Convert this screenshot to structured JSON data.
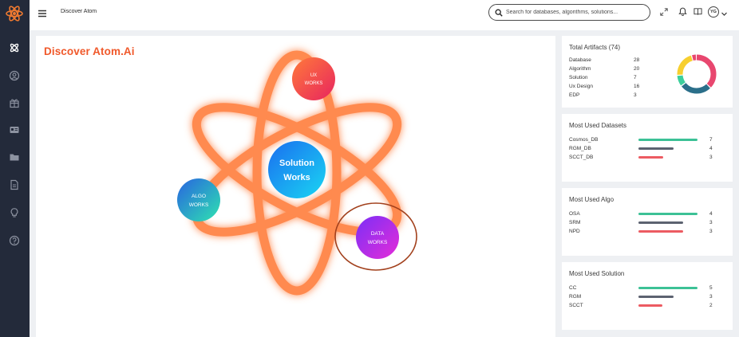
{
  "topbar": {
    "title": "Discover Atom",
    "search_placeholder": "Search for databases, algorithms, solutions...",
    "avatar_initials": "YG"
  },
  "sidebar": {
    "icons": [
      "atom-icon",
      "user-circle-icon",
      "gift-icon",
      "id-card-icon",
      "folder-icon",
      "document-icon",
      "lightbulb-icon",
      "help-icon"
    ]
  },
  "main": {
    "title": "Discover Atom.Ai",
    "nodes": {
      "ux": [
        "UX",
        "WORKS"
      ],
      "solution": [
        "Solution",
        "Works"
      ],
      "algo": [
        "ALGO",
        "WORKS"
      ],
      "data": [
        "DATA",
        "WORKS"
      ]
    }
  },
  "artifacts": {
    "title": "Total Artifacts (74)",
    "rows": [
      {
        "label": "Database",
        "value": "28"
      },
      {
        "label": "Algorithm",
        "value": "20"
      },
      {
        "label": "Solution",
        "value": "7"
      },
      {
        "label": "Ux Design",
        "value": "16"
      },
      {
        "label": "EDP",
        "value": "3"
      }
    ],
    "donut_colors": [
      "#e8476f",
      "#2b6f8a",
      "#3ccf9c",
      "#f7cf2f"
    ]
  },
  "datasets": {
    "title": "Most Used Datasets",
    "rows": [
      {
        "label": "Cosmos_DB",
        "value": "7",
        "fraction": 1.0,
        "color": "#3cc196"
      },
      {
        "label": "RGM_DB",
        "value": "4",
        "fraction": 0.6,
        "color": "#5c6270"
      },
      {
        "label": "SCCT_DB",
        "value": "3",
        "fraction": 0.42,
        "color": "#ec5b62"
      }
    ]
  },
  "algo": {
    "title": "Most Used Algo",
    "rows": [
      {
        "label": "OSA",
        "value": "4",
        "fraction": 1.0,
        "color": "#3cc196"
      },
      {
        "label": "SRM",
        "value": "3",
        "fraction": 0.75,
        "color": "#5c6270"
      },
      {
        "label": "NPD",
        "value": "3",
        "fraction": 0.75,
        "color": "#ec5b62"
      }
    ]
  },
  "solution": {
    "title": "Most Used Solution",
    "rows": [
      {
        "label": "CC",
        "value": "5",
        "fraction": 1.0,
        "color": "#3cc196"
      },
      {
        "label": "RGM",
        "value": "3",
        "fraction": 0.6,
        "color": "#5c6270"
      },
      {
        "label": "SCCT",
        "value": "2",
        "fraction": 0.4,
        "color": "#ec5b62"
      }
    ]
  }
}
